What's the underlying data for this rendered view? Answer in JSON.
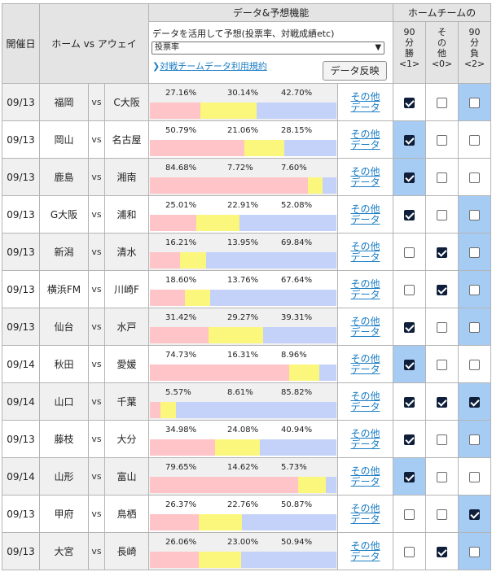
{
  "header": {
    "date": "開催日",
    "matchup": "ホーム vs アウェイ",
    "data_feature": "データ&予想機能",
    "home_team_group": "ホームチームの",
    "description": "データを活用して予想(投票率、対戦成績etc)",
    "select_value": "投票率",
    "terms_link": "対戦チームデータ利用規約",
    "reflect_button": "データ反映",
    "col_win": [
      "90",
      "分",
      "勝",
      "<1>"
    ],
    "col_other": [
      "そ",
      "の",
      "他",
      "<0>"
    ],
    "col_lose": [
      "90",
      "分",
      "負",
      "<2>"
    ]
  },
  "vs_label": "vs",
  "other_data_label": [
    "その他",
    "データ"
  ],
  "colors": {
    "home": "#ffc4c8",
    "draw": "#fbf67c",
    "away": "#c4d2fa",
    "highlight": "#a7ccf4"
  },
  "rows": [
    {
      "date": "09/13",
      "home": "福岡",
      "away": "C大阪",
      "p": [
        "27.16%",
        "30.14%",
        "42.70%"
      ],
      "v": [
        27.16,
        30.14,
        42.7
      ],
      "checks": [
        true,
        false,
        false
      ],
      "hl": [
        false,
        false,
        true
      ]
    },
    {
      "date": "09/13",
      "home": "岡山",
      "away": "名古屋",
      "p": [
        "50.79%",
        "21.06%",
        "28.15%"
      ],
      "v": [
        50.79,
        21.06,
        28.15
      ],
      "checks": [
        true,
        false,
        false
      ],
      "hl": [
        true,
        false,
        false
      ]
    },
    {
      "date": "09/13",
      "home": "鹿島",
      "away": "湘南",
      "p": [
        "84.68%",
        "7.72%",
        "7.60%"
      ],
      "v": [
        84.68,
        7.72,
        7.6
      ],
      "checks": [
        true,
        false,
        false
      ],
      "hl": [
        true,
        false,
        false
      ]
    },
    {
      "date": "09/13",
      "home": "G大阪",
      "away": "浦和",
      "p": [
        "25.01%",
        "22.91%",
        "52.08%"
      ],
      "v": [
        25.01,
        22.91,
        52.08
      ],
      "checks": [
        true,
        false,
        false
      ],
      "hl": [
        false,
        false,
        true
      ]
    },
    {
      "date": "09/13",
      "home": "新潟",
      "away": "清水",
      "p": [
        "16.21%",
        "13.95%",
        "69.84%"
      ],
      "v": [
        16.21,
        13.95,
        69.84
      ],
      "checks": [
        false,
        true,
        false
      ],
      "hl": [
        false,
        false,
        true
      ]
    },
    {
      "date": "09/13",
      "home": "横浜FM",
      "away": "川崎F",
      "p": [
        "18.60%",
        "13.76%",
        "67.64%"
      ],
      "v": [
        18.6,
        13.76,
        67.64
      ],
      "checks": [
        false,
        true,
        false
      ],
      "hl": [
        false,
        false,
        true
      ]
    },
    {
      "date": "09/13",
      "home": "仙台",
      "away": "水戸",
      "p": [
        "31.42%",
        "29.27%",
        "39.31%"
      ],
      "v": [
        31.42,
        29.27,
        39.31
      ],
      "checks": [
        true,
        false,
        false
      ],
      "hl": [
        false,
        false,
        true
      ]
    },
    {
      "date": "09/14",
      "home": "秋田",
      "away": "愛媛",
      "p": [
        "74.73%",
        "16.31%",
        "8.96%"
      ],
      "v": [
        74.73,
        16.31,
        8.96
      ],
      "checks": [
        true,
        false,
        false
      ],
      "hl": [
        true,
        false,
        false
      ]
    },
    {
      "date": "09/14",
      "home": "山口",
      "away": "千葉",
      "p": [
        "5.57%",
        "8.61%",
        "85.82%"
      ],
      "v": [
        5.57,
        8.61,
        85.82
      ],
      "checks": [
        true,
        true,
        true
      ],
      "hl": [
        false,
        false,
        true
      ]
    },
    {
      "date": "09/13",
      "home": "藤枝",
      "away": "大分",
      "p": [
        "34.98%",
        "24.08%",
        "40.94%"
      ],
      "v": [
        34.98,
        24.08,
        40.94
      ],
      "checks": [
        true,
        false,
        false
      ],
      "hl": [
        false,
        false,
        true
      ]
    },
    {
      "date": "09/14",
      "home": "山形",
      "away": "富山",
      "p": [
        "79.65%",
        "14.62%",
        "5.73%"
      ],
      "v": [
        79.65,
        14.62,
        5.73
      ],
      "checks": [
        true,
        false,
        false
      ],
      "hl": [
        true,
        false,
        false
      ]
    },
    {
      "date": "09/13",
      "home": "甲府",
      "away": "鳥栖",
      "p": [
        "26.37%",
        "22.76%",
        "50.87%"
      ],
      "v": [
        26.37,
        22.76,
        50.87
      ],
      "checks": [
        false,
        false,
        true
      ],
      "hl": [
        false,
        false,
        true
      ]
    },
    {
      "date": "09/13",
      "home": "大宮",
      "away": "長崎",
      "p": [
        "26.06%",
        "23.00%",
        "50.94%"
      ],
      "v": [
        26.06,
        23.0,
        50.94
      ],
      "checks": [
        false,
        true,
        false
      ],
      "hl": [
        false,
        false,
        true
      ]
    }
  ]
}
